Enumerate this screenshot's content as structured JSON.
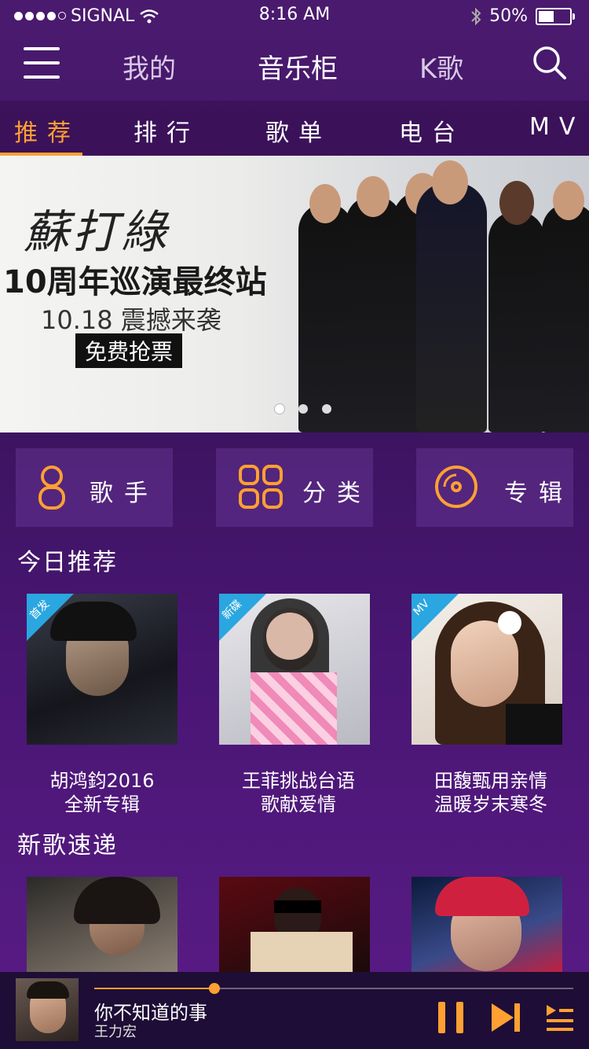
{
  "status": {
    "signal": "SIGNAL",
    "time": "8:16 AM",
    "battery": "50%",
    "battery_level": 0.5
  },
  "header": {
    "nav": [
      "我的",
      "音乐柜",
      "K歌"
    ]
  },
  "tabs": [
    "推荐",
    "排行",
    "歌单",
    "电台",
    "MV"
  ],
  "banner": {
    "calligraphy": "蘇打綠",
    "title": "10周年巡演最终站",
    "subtitle": "10.18 震撼来袭",
    "button": "免费抢票"
  },
  "categories": [
    "歌手",
    "分类",
    "专辑"
  ],
  "today": {
    "title": "今日推荐",
    "items": [
      {
        "badge": "首发",
        "line1": "胡鸿鈞2016",
        "line2": "全新专辑"
      },
      {
        "badge": "新碟",
        "line1": "王菲挑战台语",
        "line2": "歌献爱情"
      },
      {
        "badge": "MV",
        "line1": "田馥甄用亲情",
        "line2": "温暖岁末寒冬"
      }
    ]
  },
  "newsongs": {
    "title": "新歌速递"
  },
  "player": {
    "song": "你不知道的事",
    "artist": "王力宏",
    "progress": 0.25
  },
  "colors": {
    "accent": "#ffa032",
    "badge": "#2aa6e0"
  }
}
